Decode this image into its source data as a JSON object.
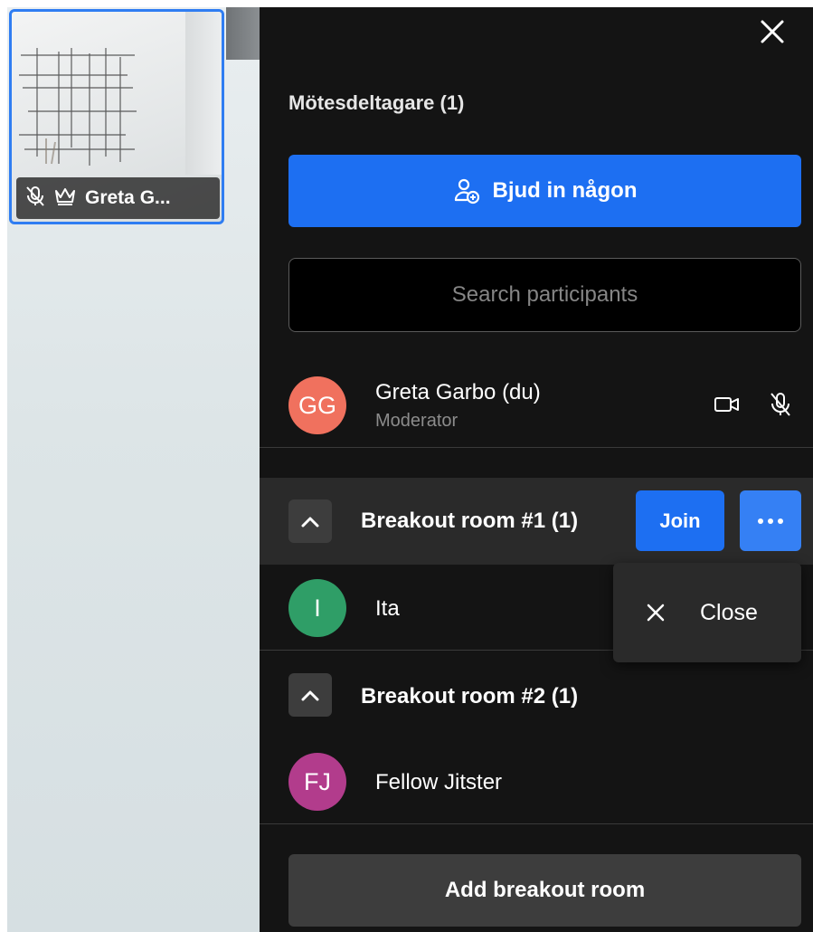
{
  "thumbnail": {
    "display_name": "Greta G...",
    "icons": [
      "mic-muted-icon",
      "crown-icon"
    ]
  },
  "panel": {
    "title": "Mötesdeltagare (1)",
    "invite_label": "Bjud in någon",
    "search_placeholder": "Search participants",
    "self": {
      "initials": "GG",
      "name": "Greta Garbo (du)",
      "role": "Moderator",
      "avatar_color": "#f0715e"
    },
    "rooms": [
      {
        "title": "Breakout room #1 (1)",
        "join_label": "Join",
        "participants": [
          {
            "initials": "I",
            "name": "Ita",
            "avatar_color": "#2f9e67"
          }
        ]
      },
      {
        "title": "Breakout room #2 (1)",
        "participants": [
          {
            "initials": "FJ",
            "name": "Fellow Jitster",
            "avatar_color": "#b23c8c"
          }
        ]
      }
    ],
    "context_menu": {
      "close_label": "Close"
    },
    "add_room_label": "Add breakout room"
  },
  "colors": {
    "primary": "#1d6ff2",
    "panel_bg": "#141414",
    "button_dark": "#3d3d3d"
  }
}
